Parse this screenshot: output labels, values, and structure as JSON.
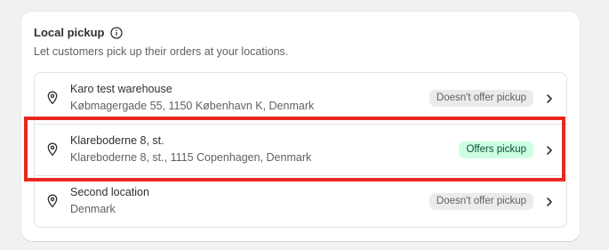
{
  "card": {
    "title": "Local pickup",
    "subtitle": "Let customers pick up their orders at your locations."
  },
  "icons": {
    "info": "info-circle-icon",
    "location": "location-pin-icon",
    "chevron": "chevron-right-icon"
  },
  "locations": [
    {
      "name": "Karo test warehouse",
      "address": "Købmagergade 55, 1150 København K, Denmark",
      "status": "Doesn't offer pickup",
      "status_tone": "neutral"
    },
    {
      "name": "Klareboderne 8, st.",
      "address": "Klareboderne 8, st., 1115 Copenhagen, Denmark",
      "status": "Offers pickup",
      "status_tone": "success"
    },
    {
      "name": "Second location",
      "address": "Denmark",
      "status": "Doesn't offer pickup",
      "status_tone": "neutral"
    }
  ],
  "colors": {
    "highlight": "#e8281f",
    "success_badge_bg": "#cdfee1",
    "neutral_badge_bg": "#ebebeb"
  }
}
